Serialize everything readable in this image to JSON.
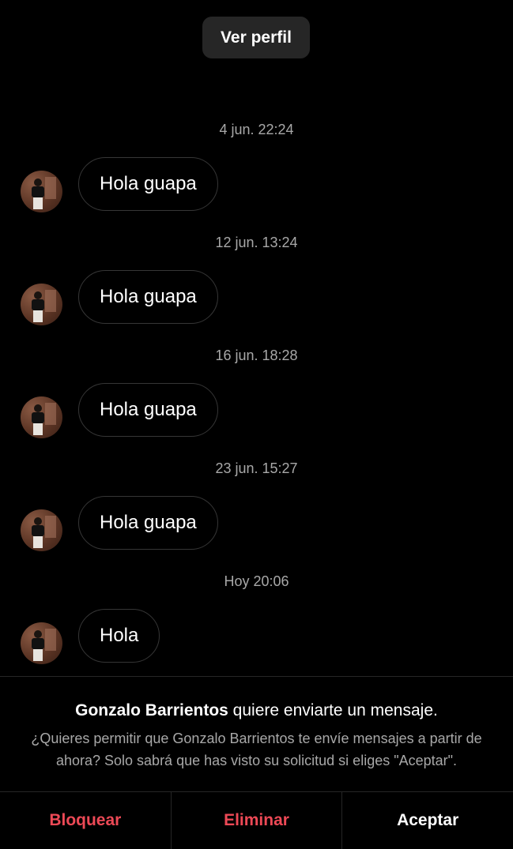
{
  "header": {
    "view_profile_label": "Ver perfil"
  },
  "messages": [
    {
      "timestamp": "4 jun. 22:24",
      "text": "Hola guapa"
    },
    {
      "timestamp": "12 jun. 13:24",
      "text": "Hola guapa"
    },
    {
      "timestamp": "16 jun. 18:28",
      "text": "Hola guapa"
    },
    {
      "timestamp": "23 jun. 15:27",
      "text": "Hola guapa"
    },
    {
      "timestamp": "Hoy 20:06",
      "text": "Hola"
    }
  ],
  "request": {
    "sender_name": "Gonzalo Barrientos",
    "title_suffix": " quiere enviarte un mensaje.",
    "body": "¿Quieres permitir que Gonzalo Barrientos te envíe mensajes a partir de ahora? Solo sabrá que has visto su solicitud si eliges \"Aceptar\"."
  },
  "actions": {
    "block_label": "Bloquear",
    "delete_label": "Eliminar",
    "accept_label": "Aceptar"
  },
  "colors": {
    "background": "#000000",
    "danger": "#ed4956",
    "muted_text": "#a8a8a8"
  }
}
